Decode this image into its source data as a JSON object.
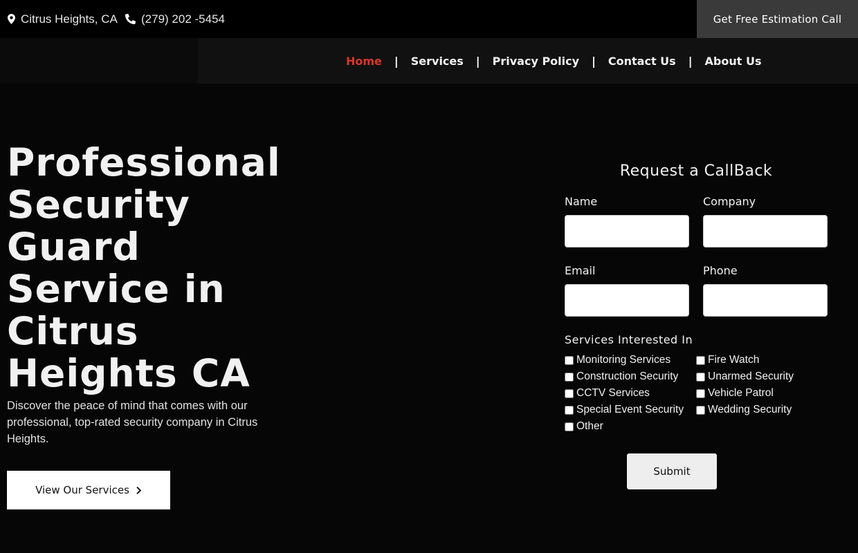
{
  "topbar": {
    "location": "Citrus Heights, CA",
    "phone": "(279) 202 -5454",
    "cta_label": "Get Free Estimation Call"
  },
  "nav": {
    "items": [
      {
        "label": "Home",
        "active": true
      },
      {
        "label": "Services"
      },
      {
        "label": "Privacy Policy"
      },
      {
        "label": "Contact Us"
      },
      {
        "label": "About Us"
      }
    ],
    "separator": "|",
    "active_color": "#d9362b"
  },
  "hero": {
    "title_lines": [
      "Professional",
      "Security",
      "Guard",
      "Service in",
      "Citrus",
      "Heights CA"
    ],
    "description": "Discover the peace of mind that comes with our professional, top-rated security company in Citrus Heights.",
    "button_label": "View Our Services"
  },
  "form": {
    "title": "Request a CallBack",
    "fields": {
      "name_label": "Name",
      "company_label": "Company",
      "email_label": "Email",
      "phone_label": "Phone"
    },
    "services_label": "Services Interested In",
    "services": [
      "Monitoring Services",
      "Fire Watch",
      "Construction Security",
      "Unarmed Security",
      "CCTV Services",
      "Vehicle Patrol",
      "Special Event Security",
      "Wedding Security",
      "Other"
    ],
    "submit_label": "Submit"
  },
  "colors": {
    "background": "#060606",
    "accent": "#d9362b"
  }
}
